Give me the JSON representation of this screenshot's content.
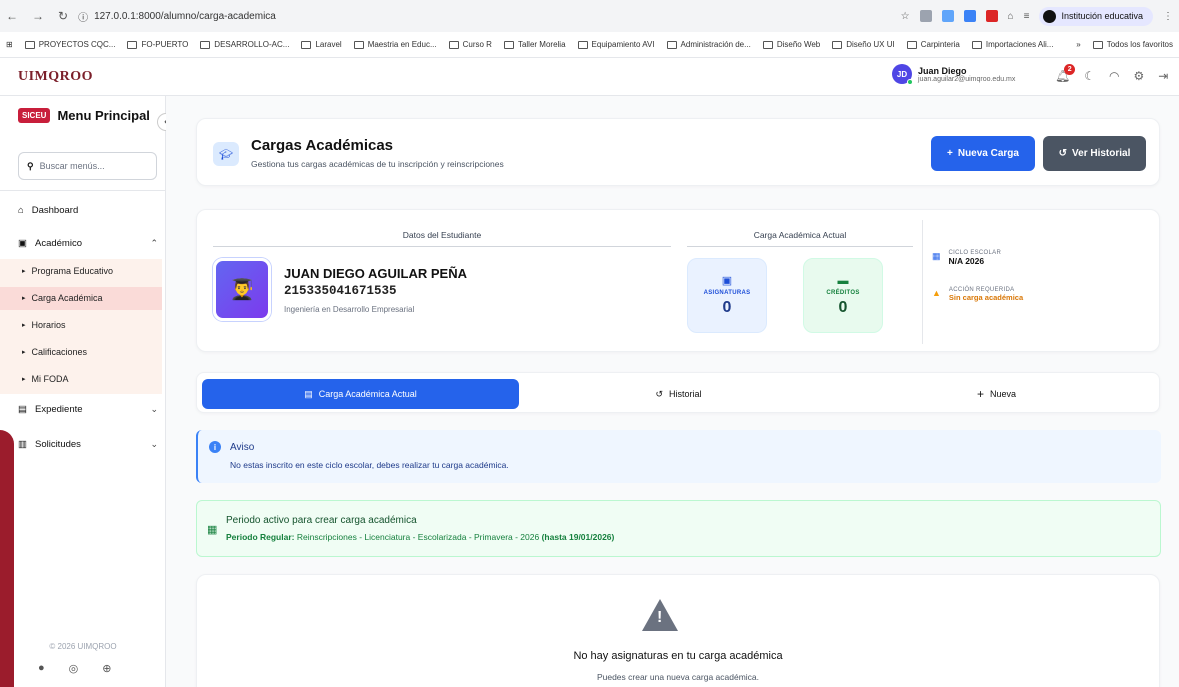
{
  "browser": {
    "url": "127.0.0.1:8000/alumno/carga-academica",
    "profile": "Institución educativa",
    "bookmarks": [
      "PROYECTOS CQC...",
      "FO-PUERTO",
      "DESARROLLO-AC...",
      "Laravel",
      "Maestria en Educ...",
      "Curso R",
      "Taller Morelia",
      "Equipamiento AVI",
      "Administración de...",
      "Diseño Web",
      "Diseño UX UI",
      "Carpinteria",
      "Importaciones Ali..."
    ],
    "bookmarks_more": "»",
    "all_bookmarks": "Todos los favoritos"
  },
  "header": {
    "logo_text": "UIMQROO",
    "user_initials": "JD",
    "user_name": "Juan Diego",
    "user_email": "juan.aguilar2@uimqroo.edu.mx",
    "notifications": "2"
  },
  "sidebar": {
    "badge": "SICEU",
    "title": "Menu Principal",
    "collapse": "‹",
    "search_placeholder": "Buscar menús...",
    "dashboard": "Dashboard",
    "academico": "Académico",
    "sub_items": [
      "Programa Educativo",
      "Carga Académica",
      "Horarios",
      "Calificaciones",
      "Mi FODA"
    ],
    "expediente": "Expediente",
    "solicitudes": "Solicitudes",
    "footer": "© 2026 UIMQROO"
  },
  "page": {
    "title": "Cargas Académicas",
    "subtitle": "Gestiona tus cargas académicas de tu inscripción y reinscripciones",
    "btn_new": "Nueva Carga",
    "btn_history": "Ver Historial"
  },
  "student": {
    "section_label": "Datos del Estudiante",
    "name": "JUAN DIEGO AGUILAR PEÑA",
    "id": "215335041671535",
    "program": "Ingeniería en Desarrollo Empresarial"
  },
  "load": {
    "section_label": "Carga Académica Actual",
    "subjects_label": "ASIGNATURAS",
    "subjects_value": "0",
    "credits_label": "CRÉDITOS",
    "credits_value": "0"
  },
  "cycle": {
    "label": "CICLO ESCOLAR",
    "value": "N/A 2026",
    "action_label": "ACCIÓN REQUERIDA",
    "action_value": "Sin carga académica"
  },
  "tabs": [
    {
      "label": "Carga Académica Actual",
      "icon": "clipboard-icon",
      "active": true
    },
    {
      "label": "Historial",
      "icon": "history-icon",
      "active": false
    },
    {
      "label": "Nueva",
      "icon": "plus-icon",
      "active": false
    }
  ],
  "notice": {
    "title": "Aviso",
    "text": "No estas inscrito en este ciclo escolar, debes realizar tu carga académica."
  },
  "period": {
    "title": "Periodo activo para crear carga académica",
    "prefix": "Periodo Regular:",
    "detail": "Reinscripciones - Licenciatura - Escolarizada - Primavera - 2026",
    "deadline": "(hasta 19/01/2026)"
  },
  "empty": {
    "title": "No hay asignaturas en tu carga académica",
    "text": "Puedes crear una nueva carga académica."
  },
  "colors": {
    "primary": "#2563eb",
    "brand": "#7b1f2a",
    "siceu": "#c81e3b",
    "success": "#15803d",
    "warning": "#f59e0b"
  }
}
